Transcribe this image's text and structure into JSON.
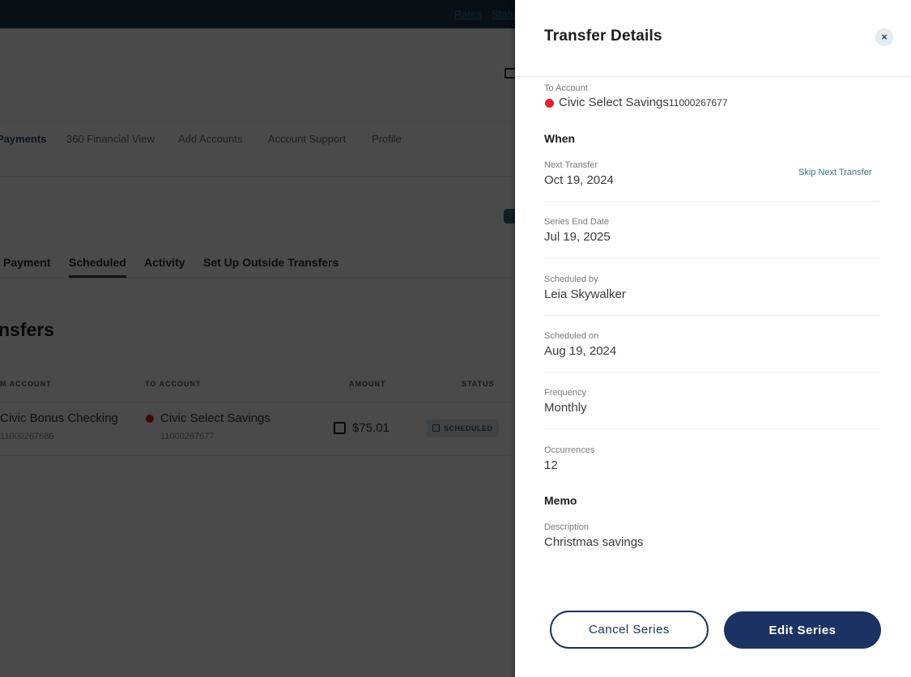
{
  "background": {
    "utility_links": [
      "Rates",
      "Statu"
    ],
    "main_nav": [
      "Payments",
      "360 Financial View",
      "Add Accounts",
      "Account Support",
      "Profile"
    ],
    "sub_tabs": [
      "Payment",
      "Scheduled",
      "Activity",
      "Set Up Outside Transfers"
    ],
    "section_title": "nsfers",
    "table": {
      "headers": [
        "M ACCOUNT",
        "TO ACCOUNT",
        "AMOUNT",
        "STATUS"
      ],
      "rows": [
        {
          "from_name": "Civic Bonus Checking",
          "from_number": "11000267686",
          "to_name": "Civic Select Savings",
          "to_number": "11000267677",
          "amount": "$75.01",
          "status": "SCHEDULED"
        }
      ]
    },
    "colors": {
      "topbar": "#1e3a4c",
      "account_dot": "#d8202c",
      "active_tab_underline": "#1f4c6b"
    }
  },
  "drawer": {
    "title": "Transfer Details",
    "close_label": "×",
    "to_account": {
      "label": "To Account",
      "name": "Civic Select Savings",
      "number": "11000267677",
      "dot_color": "#e8202c"
    },
    "when": {
      "heading": "When",
      "next_transfer": {
        "label": "Next Transfer",
        "value": "Oct 19, 2024",
        "action": "Skip Next Transfer"
      },
      "series_end": {
        "label": "Series End Date",
        "value": "Jul 19, 2025"
      },
      "scheduled_by": {
        "label": "Scheduled by",
        "value": "Leia Skywalker"
      },
      "scheduled_on": {
        "label": "Scheduled on",
        "value": "Aug 19, 2024"
      },
      "frequency": {
        "label": "Frequency",
        "value": "Monthly"
      },
      "occurrences": {
        "label": "Occurrences",
        "value": "12"
      }
    },
    "memo": {
      "heading": "Memo",
      "description": {
        "label": "Description",
        "value": "Christmas savings"
      }
    },
    "buttons": {
      "cancel": "Cancel Series",
      "edit": "Edit Series"
    },
    "colors": {
      "primary": "#1c3262",
      "link": "#3d6d8c"
    }
  }
}
